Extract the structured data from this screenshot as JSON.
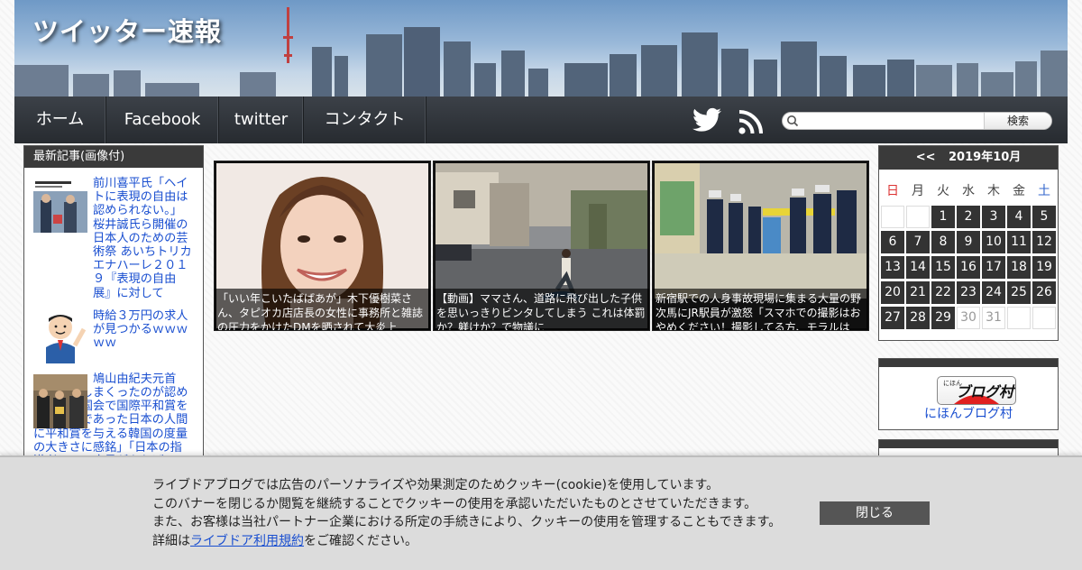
{
  "header": {
    "site_title": "ツイッター速報"
  },
  "nav": {
    "items": [
      {
        "label": "ホーム"
      },
      {
        "label": "Facebook"
      },
      {
        "label": "twitter"
      },
      {
        "label": "コンタクト"
      }
    ],
    "search_button": "検索"
  },
  "sidebar": {
    "heading": "最新記事(画像付)",
    "items": [
      {
        "title": "前川喜平氏「ヘイトに表現の自由は認められない。」 桜井誠氏ら開催の日本人のための芸術祭 あいちトリカエナハーレ２０１９『表現の自由展』に対して"
      },
      {
        "title": "時給３万円の求人が見つかるｗｗｗｗｗ"
      },
      {
        "title": "鳩山由紀夫元首相、謝罪しまくったのが認められ韓国国会で国際平和賞を受賞「敵であった日本の人間に平和賞を与える韓国の度量の大きさに感銘」「日本の指導者にこの度量があれば"
      }
    ]
  },
  "articles": [
    {
      "caption": "「いい年こいたばばあが」木下優樹菜さん、タピオカ店店長の女性に事務所と雑誌の圧力をかけたDMを晒されて大炎上"
    },
    {
      "caption": "【動画】ママさん、道路に飛び出した子供を思いっきりビンタしてしまう これは体罰か？躾けか？で物議に"
    },
    {
      "caption": "新宿駅での人身事故現場に集まる大量の野次馬にJR駅員が激怒「スマホでの撮影はおやめください！撮影してる方、モラルは"
    }
  ],
  "calendar": {
    "prev": "<<",
    "title": "2019年10月",
    "weekdays": [
      "日",
      "月",
      "火",
      "水",
      "木",
      "金",
      "土"
    ],
    "weeks": [
      [
        "",
        "",
        "1",
        "2",
        "3",
        "4",
        "5"
      ],
      [
        "6",
        "7",
        "8",
        "9",
        "10",
        "11",
        "12"
      ],
      [
        "13",
        "14",
        "15",
        "16",
        "17",
        "18",
        "19"
      ],
      [
        "20",
        "21",
        "22",
        "23",
        "24",
        "25",
        "26"
      ],
      [
        "27",
        "28",
        "29",
        "30",
        "31",
        "",
        ""
      ]
    ],
    "last_highlighted_day": 29
  },
  "blog_village": {
    "badge_text": "ブログ村",
    "badge_small": "にほん",
    "link": "にほんブログ村"
  },
  "cookie": {
    "lines": [
      "ライブドアブログでは広告のパーソナライズや効果測定のためクッキー(cookie)を使用しています。",
      "このバナーを閉じるか閲覧を継続することでクッキーの使用を承認いただいたものとさせていただきます。",
      "また、お客様は当社パートナー企業における所定の手続きにより、クッキーの使用を管理することもできます。"
    ],
    "detail_prefix": "詳細は",
    "detail_link": "ライブドア利用規約",
    "detail_suffix": "をご確認ください。",
    "close": "閉じる"
  },
  "colors": {
    "nav_bg": "#2f3338",
    "link": "#1a4fd0",
    "sunday": "#dd3333",
    "saturday": "#3366cc"
  }
}
